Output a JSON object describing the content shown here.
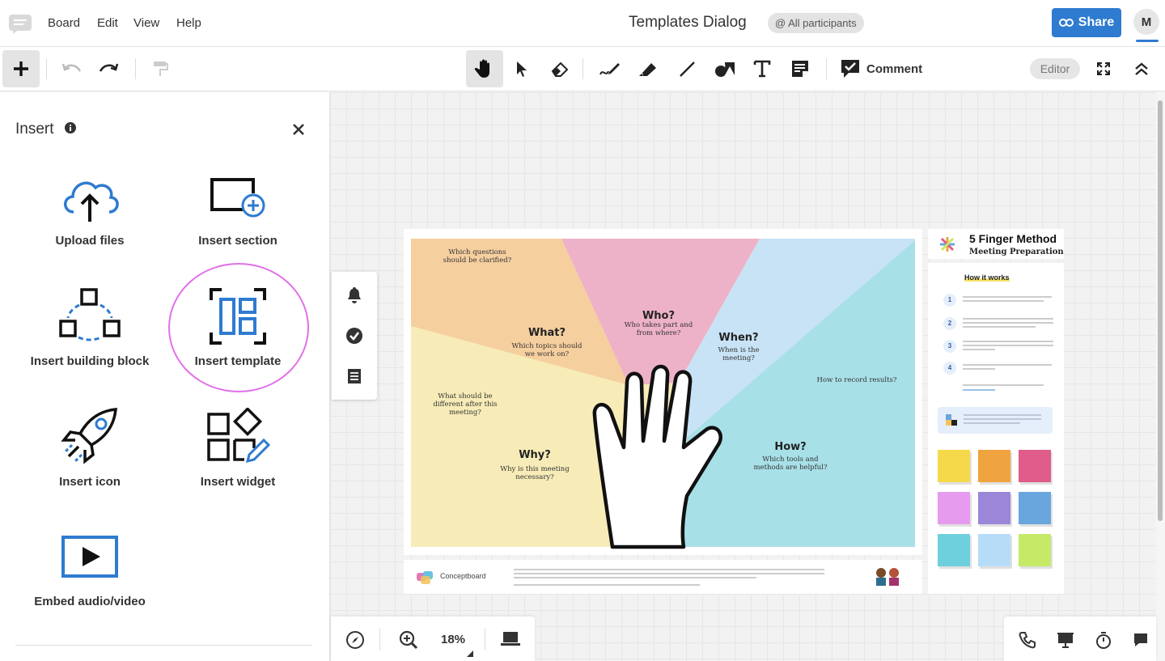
{
  "menu": {
    "items": [
      "Board",
      "Edit",
      "View",
      "Help"
    ]
  },
  "board": {
    "title": "Templates Dialog",
    "participants": "@ All participants"
  },
  "header": {
    "share_label": "Share",
    "avatar_initial": "M"
  },
  "toolbar": {
    "comment_label": "Comment",
    "editor_label": "Editor"
  },
  "insert_panel": {
    "title": "Insert",
    "items": [
      {
        "label": "Upload files",
        "icon": "cloud-upload-icon"
      },
      {
        "label": "Insert section",
        "icon": "section-add-icon"
      },
      {
        "label": "Insert building block",
        "icon": "building-block-icon"
      },
      {
        "label": "Insert template",
        "icon": "template-icon"
      },
      {
        "label": "Insert icon",
        "icon": "rocket-icon"
      },
      {
        "label": "Insert widget",
        "icon": "widget-icon"
      },
      {
        "label": "Embed audio/video",
        "icon": "video-play-icon"
      }
    ]
  },
  "template": {
    "title": "5 Finger Method",
    "subtitle": "Meeting Preparation",
    "how_it_works": "How it works",
    "sections": {
      "what": {
        "head": "What?",
        "text": "Which topics should we work on?"
      },
      "who": {
        "head": "Who?",
        "text": "Who takes part and from where?"
      },
      "when": {
        "head": "When?",
        "text": "When is the meeting?"
      },
      "how": {
        "head": "How?",
        "text": "Which tools and methods are helpful?"
      },
      "why": {
        "head": "Why?",
        "text": "Why is this meeting necessary?"
      },
      "questions": "Which questions should be clarified?",
      "different": "What should be different after this meeting?",
      "record": "How to record results?"
    },
    "steps": [
      "1",
      "2",
      "3",
      "4"
    ],
    "footer_brand": "Conceptboard",
    "sticky_colors": [
      "#f6d94a",
      "#f0a43f",
      "#e05c8a",
      "#e79bef",
      "#9b86d8",
      "#6aa6de",
      "#6fd0dd",
      "#b7dcf8",
      "#c6ea68"
    ]
  },
  "zoom": {
    "value": "18%"
  },
  "colors": {
    "accent": "#2f7bd0",
    "highlight": "#e070e8"
  }
}
